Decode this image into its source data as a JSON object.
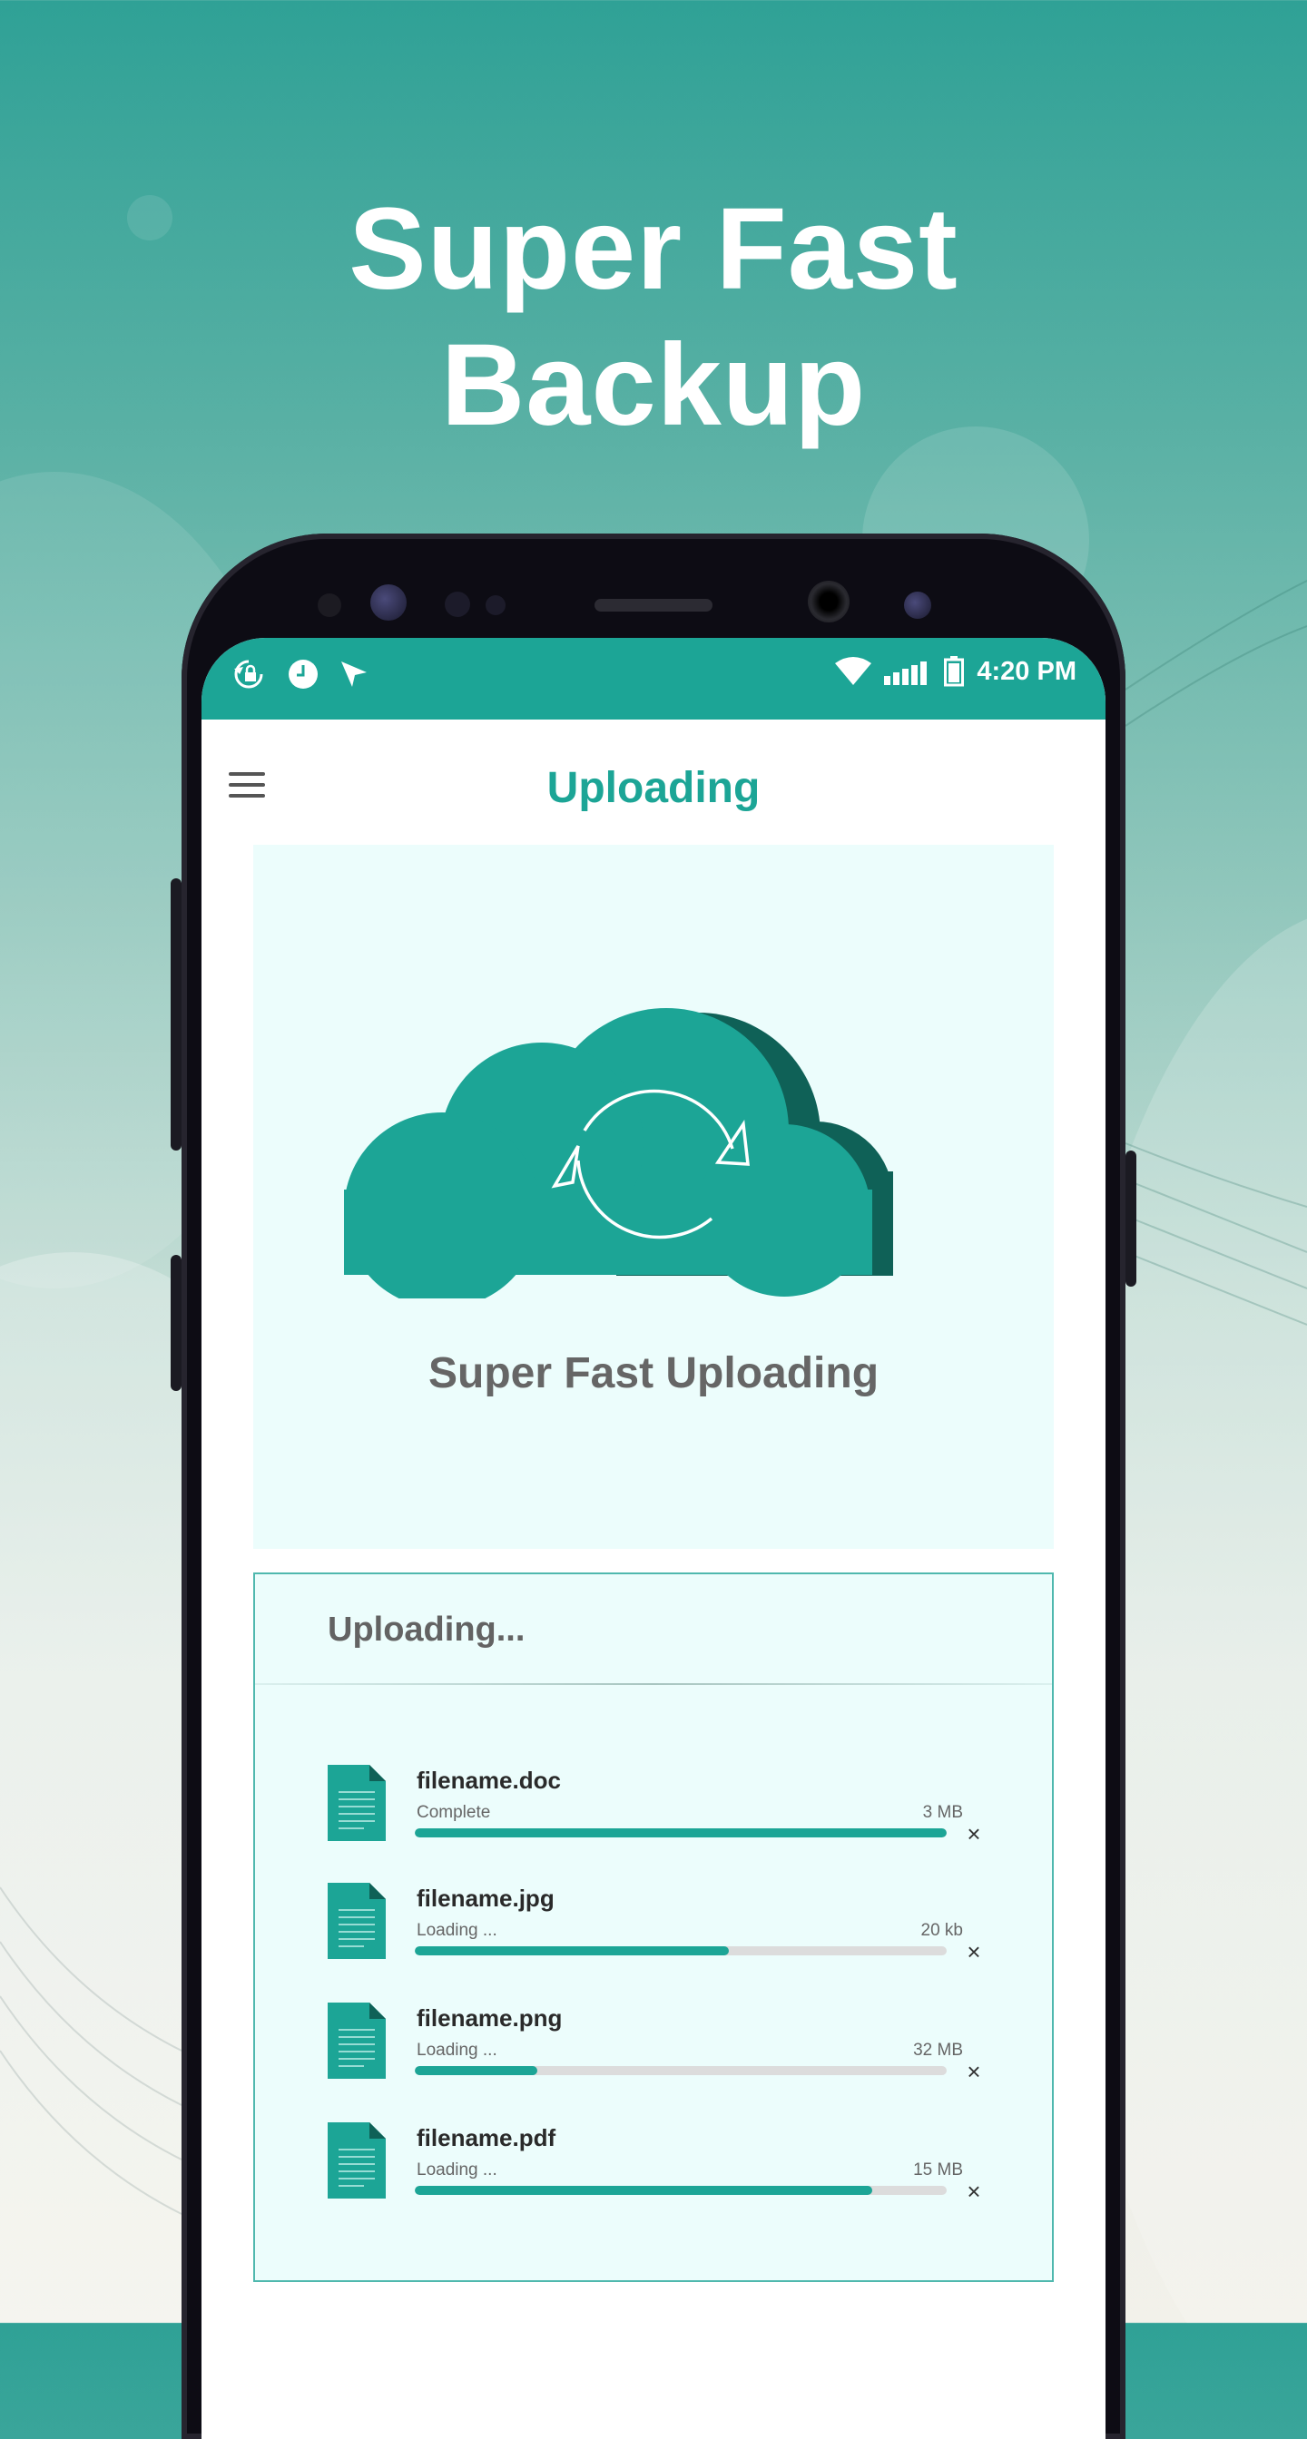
{
  "headline": {
    "line1": "Super Fast",
    "line2": "Backup"
  },
  "status_bar": {
    "time": "4:20 PM",
    "left_icons": [
      "sync-lock-icon",
      "clock-icon",
      "navigation-arrow-icon"
    ],
    "right_icons": [
      "wifi-icon",
      "signal-icon",
      "battery-icon"
    ]
  },
  "app_bar": {
    "title": "Uploading",
    "menu_icon": "hamburger-menu-icon"
  },
  "hero": {
    "caption": "Super Fast Uploading",
    "icon": "cloud-sync-icon"
  },
  "uploads": {
    "title": "Uploading...",
    "files": [
      {
        "name": "filename.doc",
        "status": "Complete",
        "size": "3 MB",
        "progress": 1.0
      },
      {
        "name": "filename.jpg",
        "status": "Loading ...",
        "size": "20 kb",
        "progress": 0.59
      },
      {
        "name": "filename.png",
        "status": "Loading ...",
        "size": "32 MB",
        "progress": 0.23
      },
      {
        "name": "filename.pdf",
        "status": "Loading ...",
        "size": "15 MB",
        "progress": 0.86
      }
    ],
    "close_glyph": "×"
  },
  "colors": {
    "accent": "#1ca596",
    "accent_dark": "#0f6157",
    "panel_bg": "#ecfdfc",
    "text_gray": "#666666"
  }
}
